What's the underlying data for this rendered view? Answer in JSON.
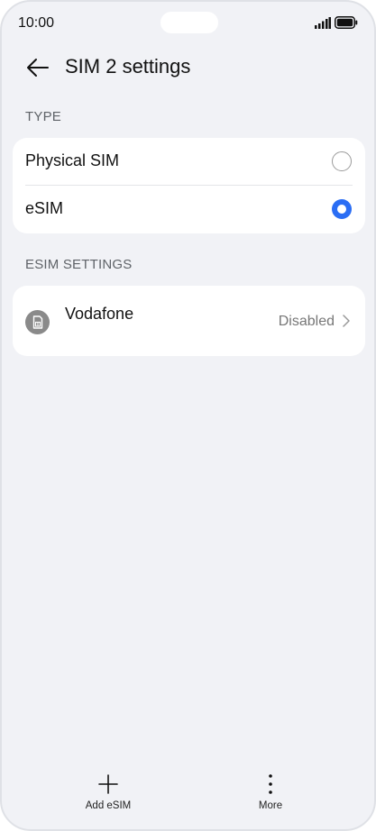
{
  "status_bar": {
    "time": "10:00"
  },
  "header": {
    "title": "SIM 2 settings"
  },
  "type_section": {
    "label": "TYPE",
    "options": [
      {
        "label": "Physical SIM",
        "selected": false
      },
      {
        "label": "eSIM",
        "selected": true
      }
    ]
  },
  "esim_section": {
    "label": "ESIM SETTINGS",
    "items": [
      {
        "name": "Vodafone",
        "status": "Disabled",
        "icon": "sim-card-icon"
      }
    ]
  },
  "bottom_bar": {
    "add": {
      "label": "Add eSIM",
      "icon": "plus-icon"
    },
    "more": {
      "label": "More",
      "icon": "more-vertical-icon"
    }
  },
  "colors": {
    "accent": "#2a6df4",
    "background": "#f1f2f6",
    "card": "#ffffff"
  }
}
